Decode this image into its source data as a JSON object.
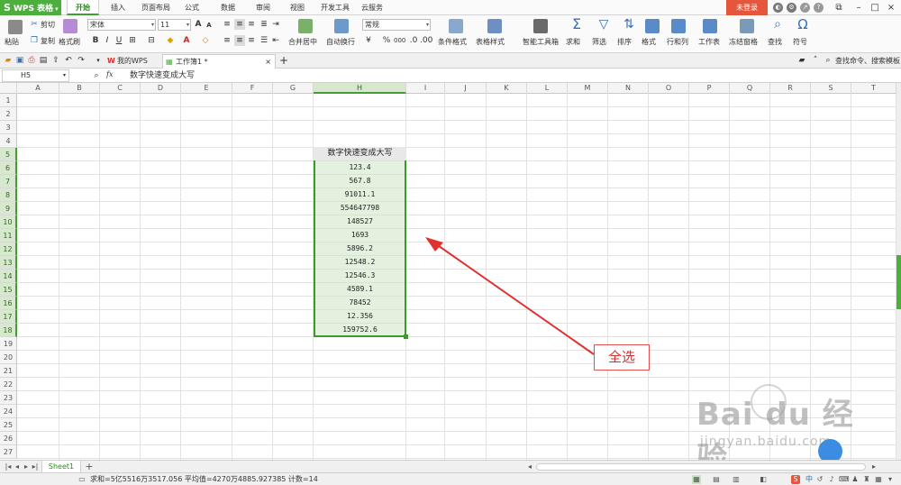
{
  "app": {
    "logo": "S",
    "name": "WPS 表格",
    "arrow": "▾"
  },
  "menu": {
    "tabs": [
      "开始",
      "插入",
      "页面布局",
      "公式",
      "数据",
      "审阅",
      "视图",
      "开发工具",
      "云服务"
    ],
    "active": "开始",
    "login": "未登录"
  },
  "ribbon": {
    "paste": "粘贴",
    "cut": "剪切",
    "copy": "复制",
    "format_painter": "格式刷",
    "font_name": "宋体",
    "font_size": "11",
    "bold": "B",
    "italic": "I",
    "underline": "U",
    "merge_center": "合并居中",
    "wrap_text": "自动换行",
    "number_format": "常规",
    "conditional_format": "条件格式",
    "table_style": "表格样式",
    "smart_toolbox": "智能工具箱",
    "sum": "求和",
    "filter": "筛选",
    "sort": "排序",
    "format": "格式",
    "row_col": "行和列",
    "worksheet": "工作表",
    "freeze": "冻结窗格",
    "find": "查找",
    "symbol": "符号",
    "percent": "%",
    "thousands": "000"
  },
  "doc_tabs": [
    {
      "label": "我的WPS",
      "active": false
    },
    {
      "label": "工作簿1 *",
      "active": true
    }
  ],
  "search_cmd": "查找命令、搜索模板",
  "formula_bar": {
    "cell_ref": "H5",
    "fx": "fx",
    "content": "数字快速变成大写"
  },
  "columns": [
    "A",
    "B",
    "C",
    "D",
    "E",
    "F",
    "G",
    "H",
    "I",
    "J",
    "K",
    "L",
    "M",
    "N",
    "O",
    "P",
    "Q",
    "R",
    "S",
    "T"
  ],
  "selected_column": "H",
  "rows": [
    "1",
    "2",
    "3",
    "4",
    "5",
    "6",
    "7",
    "8",
    "9",
    "10",
    "11",
    "12",
    "13",
    "14",
    "15",
    "16",
    "17",
    "18",
    "19",
    "20",
    "21",
    "22",
    "23",
    "24",
    "25",
    "26",
    "27"
  ],
  "table": {
    "header": "数字快速变成大写",
    "values": [
      "123.4",
      "567.8",
      "91011.1",
      "554647798",
      "148527",
      "1693",
      "5896.2",
      "12548.2",
      "12546.3",
      "4589.1",
      "78452",
      "12.356",
      "159752.6"
    ]
  },
  "annotation": "全选",
  "sheet_tabs": [
    "Sheet1"
  ],
  "status": "求和=5亿5516万3517.056    平均值=4270万4885.927385    计数=14",
  "watermark": {
    "logo": "Bai du 经验",
    "url": "jingyan.baidu.com"
  },
  "colors": {
    "accent": "#4caf3c",
    "login": "#e5563c",
    "selection": "#3b9a2b",
    "annotation": "#e03030"
  },
  "icons": [
    "paste-icon",
    "cut-icon",
    "copy-icon",
    "format-painter-icon",
    "sum-icon",
    "filter-icon",
    "sort-icon",
    "find-icon",
    "symbol-icon",
    "close-icon",
    "add-icon",
    "undo-icon",
    "redo-icon"
  ]
}
